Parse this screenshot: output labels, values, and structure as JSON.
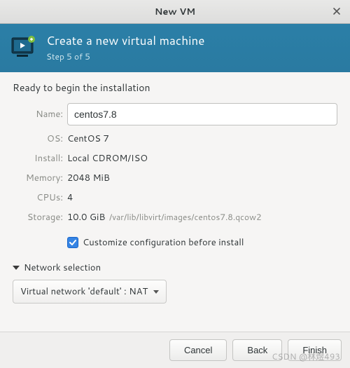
{
  "window": {
    "title": "New VM"
  },
  "header": {
    "title": "Create a new virtual machine",
    "subtitle": "Step 5 of 5"
  },
  "ready_text": "Ready to begin the installation",
  "labels": {
    "name": "Name:",
    "os": "OS:",
    "install": "Install:",
    "memory": "Memory:",
    "cpus": "CPUs:",
    "storage": "Storage:"
  },
  "values": {
    "name": "centos7.8",
    "os": "CentOS 7",
    "install": "Local CDROM/ISO",
    "memory": "2048 MiB",
    "cpus": "4",
    "storage_size": "10.0 GiB",
    "storage_path": "/var/lib/libvirt/images/centos7.8.qcow2"
  },
  "customize_label": "Customize configuration before install",
  "network": {
    "section_label": "Network selection",
    "selected": "Virtual network 'default' : NAT"
  },
  "buttons": {
    "cancel": "Cancel",
    "back": "Back",
    "finish": "Finish"
  },
  "watermark": "CSDN @林煜493"
}
